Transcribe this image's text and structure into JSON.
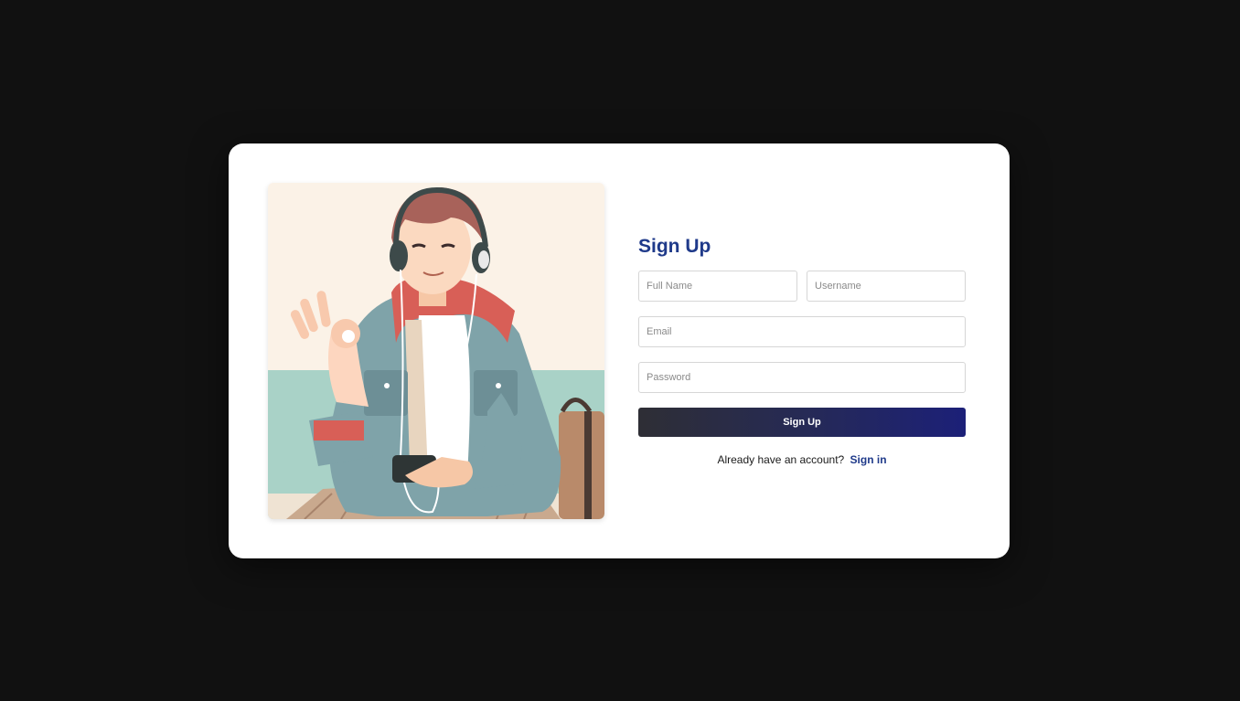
{
  "form": {
    "title": "Sign Up",
    "full_name_placeholder": "Full Name",
    "username_placeholder": "Username",
    "email_placeholder": "Email",
    "password_placeholder": "Password",
    "submit_label": "Sign Up",
    "footer_text": "Already have an account?",
    "signin_link": "Sign in"
  },
  "colors": {
    "page_background": "#111111",
    "card_background": "#ffffff",
    "title": "#1f3a8a",
    "link": "#1f3a8a",
    "button_gradient_start": "#2e2e35",
    "button_gradient_end": "#1c2078"
  },
  "illustration": {
    "subject": "person-with-headphones-illustration"
  }
}
